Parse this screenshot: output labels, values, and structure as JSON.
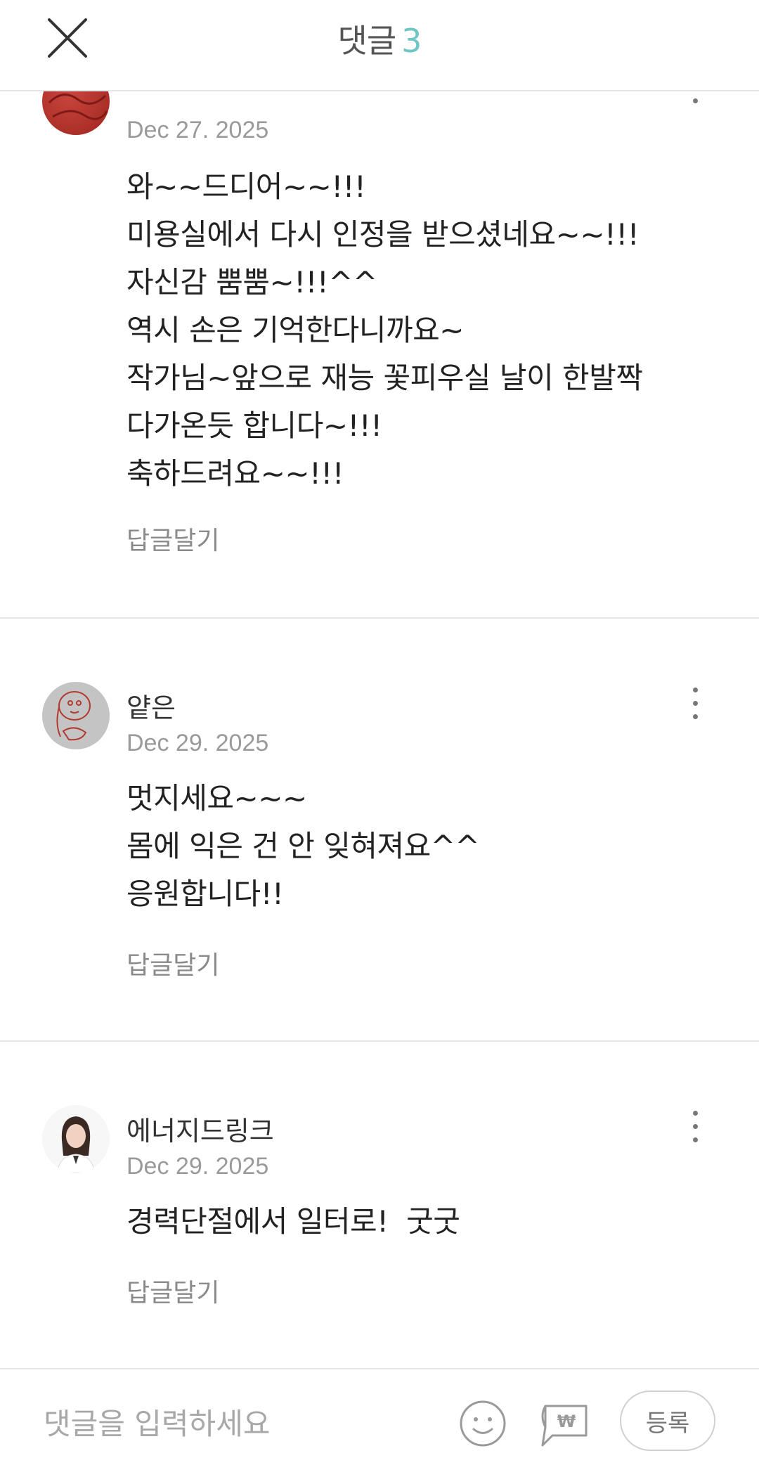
{
  "header": {
    "title": "댓글",
    "count": "3",
    "close_icon": "close-icon"
  },
  "comments": [
    {
      "author": "",
      "date": "Dec 27. 2025",
      "lines": [
        "와~~드디어~~!!!",
        "미용실에서 다시 인정을 받으셨네요~~!!!",
        "자신감 뿜뿜~!!!^^",
        "역시 손은 기억한다니까요~",
        "작가님~앞으로 재능 꽃피우실 날이 한발짝",
        "다가온듯 합니다~!!!",
        "축하드려요~~!!!"
      ],
      "reply_label": "답글달기",
      "avatar_color": "#b5312a"
    },
    {
      "author": "얕은",
      "date": "Dec 29. 2025",
      "lines": [
        "멋지세요~~~",
        "몸에 익은 건 안 잊혀져요^^",
        "응원합니다!!"
      ],
      "reply_label": "답글달기",
      "avatar_color": "#c4c4c4"
    },
    {
      "author": "에너지드링크",
      "date": "Dec 29. 2025",
      "lines": [
        "경력단절에서 일터로!  굿굿"
      ],
      "reply_label": "답글달기",
      "avatar_color": "#f2f2f2"
    }
  ],
  "footer": {
    "placeholder": "댓글을 입력하세요",
    "submit_label": "등록",
    "emoji_icon": "smile-icon",
    "donation_icon": "won-coupon-icon"
  },
  "colors": {
    "accent": "#6fc6c6",
    "divider": "#e6e6e6",
    "muted_text": "#9a9a9a"
  }
}
